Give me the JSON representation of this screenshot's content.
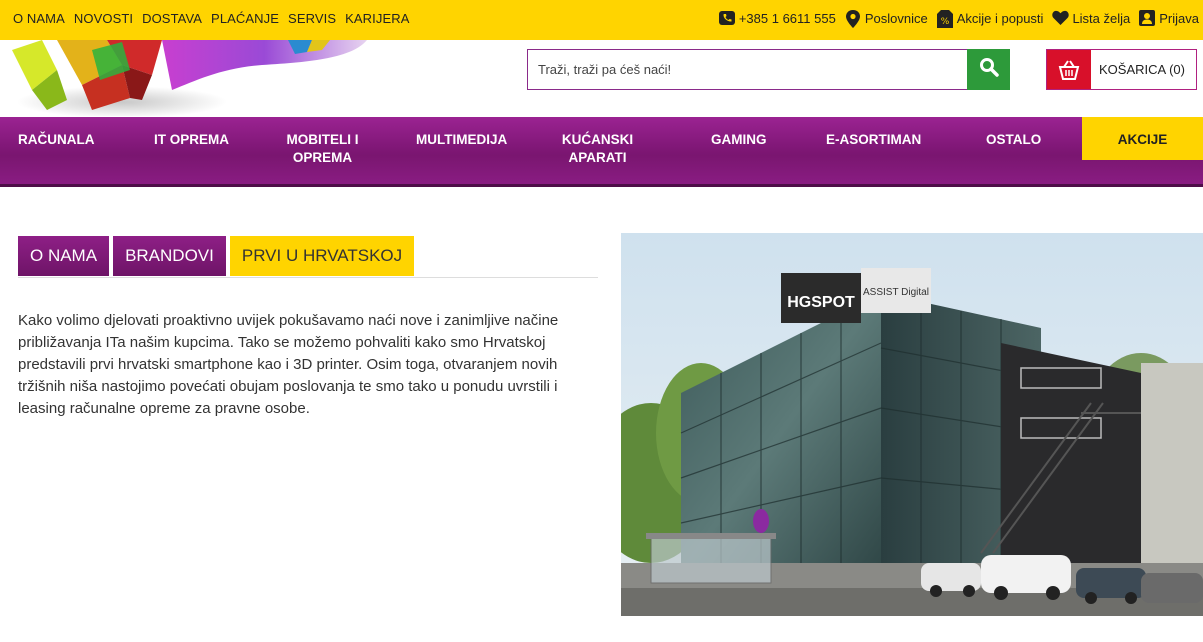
{
  "topnav": [
    "O NAMA",
    "NOVOSTI",
    "DOSTAVA",
    "PLAĆANJE",
    "SERVIS",
    "KARIJERA"
  ],
  "toplinks": [
    {
      "icon": "phone-icon",
      "label": "+385 1 6611 555"
    },
    {
      "icon": "location-pin-icon",
      "label": "Poslovnice"
    },
    {
      "icon": "discount-tag-icon",
      "label": "Akcije i popusti"
    },
    {
      "icon": "heart-icon",
      "label": "Lista želja"
    },
    {
      "icon": "user-icon",
      "label": "Prijava"
    }
  ],
  "search": {
    "placeholder": "Traži, traži pa ćeš naći!"
  },
  "cart": {
    "label": "KOŠARICA (0)"
  },
  "mainnav": [
    {
      "label": "RAČUNALA"
    },
    {
      "label": "IT OPREMA"
    },
    {
      "label": "MOBITELI I OPREMA"
    },
    {
      "label": "MULTIMEDIJA"
    },
    {
      "label": "KUĆANSKI APARATI"
    },
    {
      "label": "GAMING"
    },
    {
      "label": "E-ASORTIMAN"
    },
    {
      "label": "OSTALO"
    }
  ],
  "akcije": "AKCIJE",
  "tabs": [
    "O NAMA",
    "BRANDOVI",
    "PRVI U HRVATSKOJ"
  ],
  "active_tab": 2,
  "body_text": "Kako volimo djelovati proaktivno uvijek pokušavamo naći nove i zanimljive načine približavanja ITa našim kupcima. Tako se možemo pohvaliti kako smo Hrvatskoj predstavili prvi hrvatski smartphone kao i 3D printer. Osim toga, otvaranjem novih tržišnih niša nastojimo povećati obujam poslovanja te smo tako u ponudu uvrstili i leasing računalne opreme za pravne osobe.",
  "photo": {
    "sign_main": "HGSPOT",
    "sign_side": "ASSIST Digital"
  },
  "colors": {
    "yellow": "#ffd400",
    "purple": "#8b1d84",
    "green": "#2d9a3a",
    "red": "#d8102a"
  }
}
